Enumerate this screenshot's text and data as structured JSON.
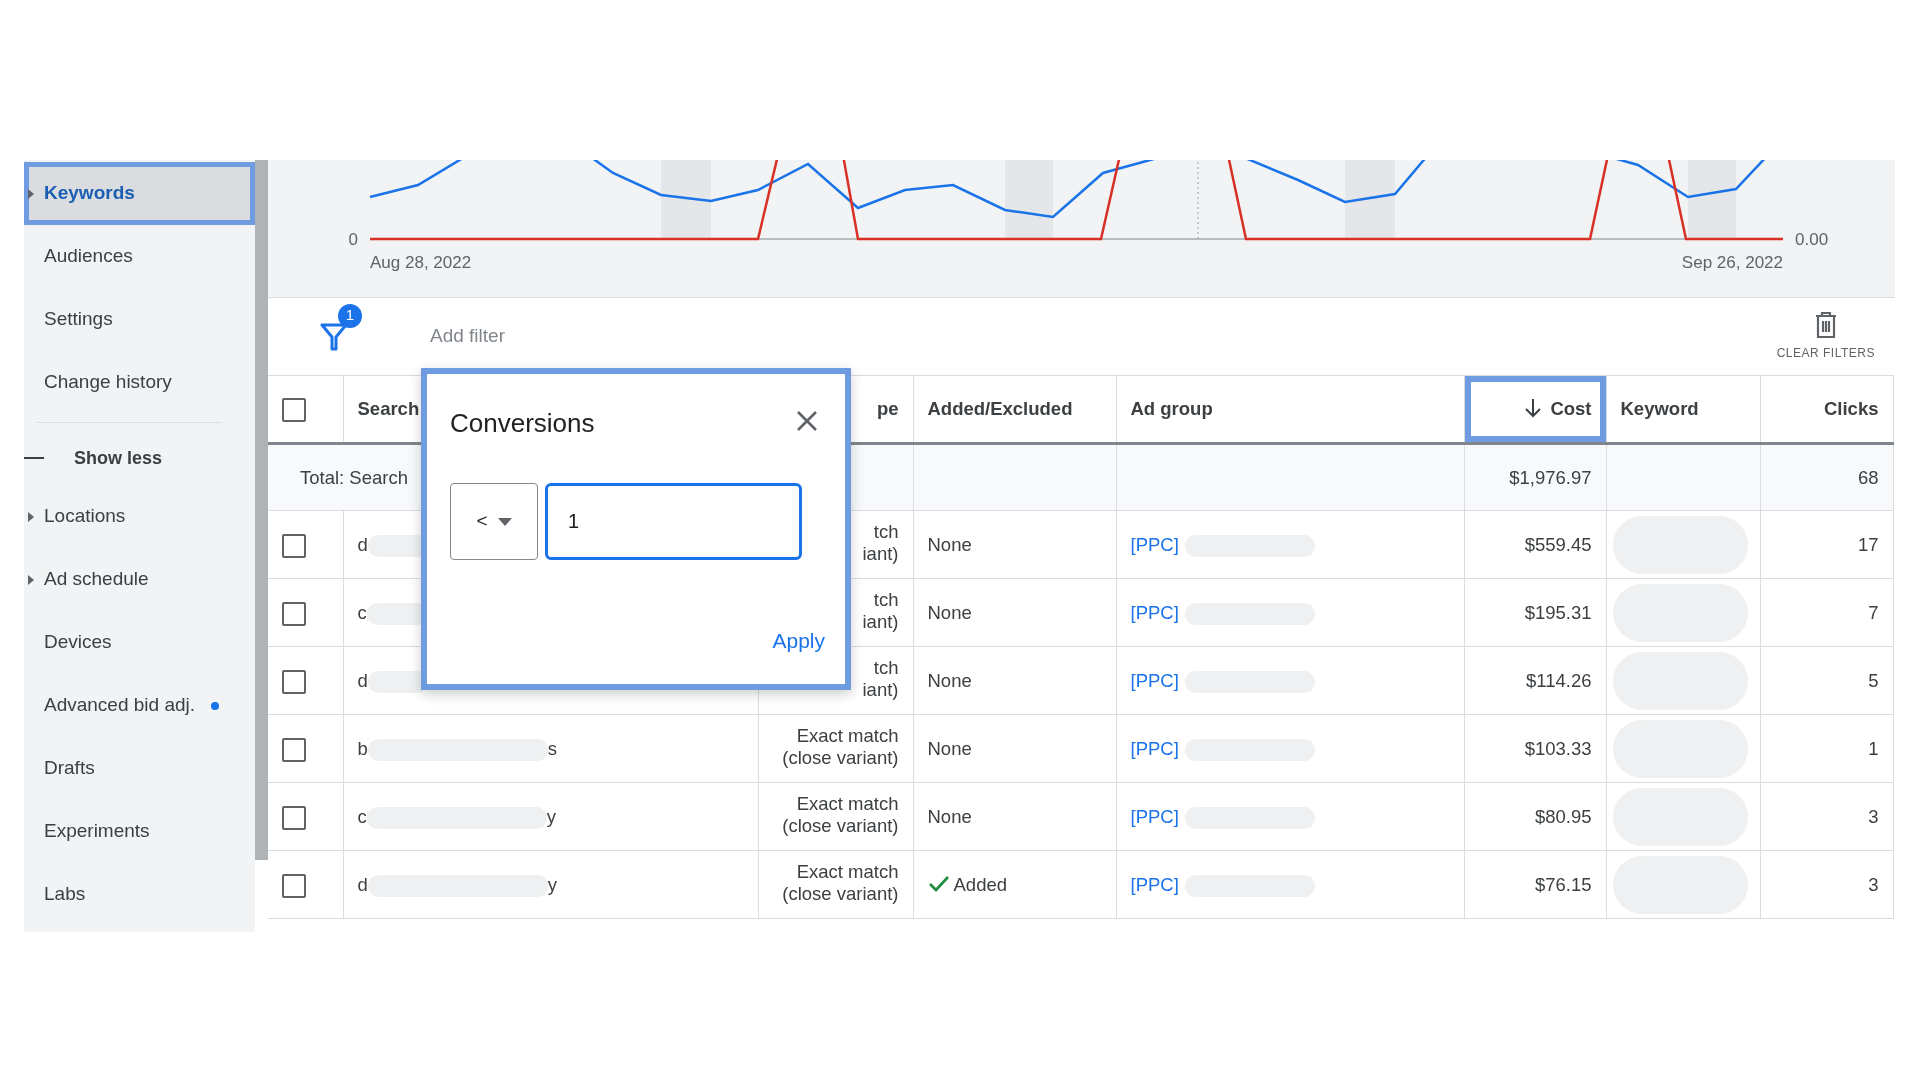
{
  "sidebar": {
    "items": [
      {
        "label": "Keywords",
        "selected": true,
        "highlighted": true,
        "expandable": true,
        "dot": false
      },
      {
        "label": "Audiences",
        "selected": false,
        "highlighted": false,
        "expandable": false,
        "dot": false
      },
      {
        "label": "Settings",
        "selected": false,
        "highlighted": false,
        "expandable": false,
        "dot": false
      },
      {
        "label": "Change history",
        "selected": false,
        "highlighted": false,
        "expandable": false,
        "dot": false
      }
    ],
    "toggle": {
      "label": "Show less"
    },
    "more_items": [
      {
        "label": "Locations",
        "selected": false,
        "highlighted": false,
        "expandable": true,
        "dot": false
      },
      {
        "label": "Ad schedule",
        "selected": false,
        "highlighted": false,
        "expandable": true,
        "dot": false
      },
      {
        "label": "Devices",
        "selected": false,
        "highlighted": false,
        "expandable": false,
        "dot": false
      },
      {
        "label": "Advanced bid adj.",
        "selected": false,
        "highlighted": false,
        "expandable": false,
        "dot": true
      },
      {
        "label": "Drafts",
        "selected": false,
        "highlighted": false,
        "expandable": false,
        "dot": false
      },
      {
        "label": "Experiments",
        "selected": false,
        "highlighted": false,
        "expandable": false,
        "dot": false
      },
      {
        "label": "Labs",
        "selected": false,
        "highlighted": false,
        "expandable": false,
        "dot": false
      }
    ]
  },
  "chart": {
    "y_left_tick": "0",
    "y_right_tick": "0.00",
    "start_date": "Aug 28, 2022",
    "end_date": "Sep 26, 2022"
  },
  "filter_bar": {
    "filter_count": "1",
    "placeholder": "Add filter",
    "clear_label": "CLEAR FILTERS"
  },
  "table": {
    "select_all_checked": false,
    "columns": [
      {
        "label": "Search",
        "sorted": false,
        "highlighted": false
      },
      {
        "label": "pe",
        "sorted": false,
        "highlighted": false
      },
      {
        "label": "Added/Excluded",
        "sorted": false,
        "highlighted": false
      },
      {
        "label": "Ad group",
        "sorted": false,
        "highlighted": false
      },
      {
        "label": "Cost",
        "sorted": true,
        "highlighted": true
      },
      {
        "label": "Keyword",
        "sorted": false,
        "highlighted": false
      },
      {
        "label": "Clicks",
        "sorted": false,
        "highlighted": false
      }
    ],
    "total": {
      "label": "Total: Search",
      "cost": "$1,976.97",
      "clicks": "68"
    },
    "rows": [
      {
        "checked": false,
        "term_start": "d",
        "match_type": [
          "tch",
          "iant)"
        ],
        "added": {
          "kind": "none",
          "label": "None"
        },
        "ad_group": "[PPC]",
        "cost": "$559.45",
        "clicks": "17"
      },
      {
        "checked": false,
        "term_start": "c",
        "match_type": [
          "tch",
          "iant)"
        ],
        "added": {
          "kind": "none",
          "label": "None"
        },
        "ad_group": "[PPC]",
        "cost": "$195.31",
        "clicks": "7"
      },
      {
        "checked": false,
        "term_start": "d",
        "match_type": [
          "tch",
          "iant)"
        ],
        "added": {
          "kind": "none",
          "label": "None"
        },
        "ad_group": "[PPC]",
        "cost": "$114.26",
        "clicks": "5"
      },
      {
        "checked": false,
        "term_start": "b",
        "term_end": "s",
        "match_type": [
          "Exact match",
          "(close variant)"
        ],
        "added": {
          "kind": "none",
          "label": "None"
        },
        "ad_group": "[PPC]",
        "cost": "$103.33",
        "clicks": "1"
      },
      {
        "checked": false,
        "term_start": "c",
        "term_end": "y",
        "match_type": [
          "Exact match",
          "(close variant)"
        ],
        "added": {
          "kind": "none",
          "label": "None"
        },
        "ad_group": "[PPC]",
        "cost": "$80.95",
        "clicks": "3"
      },
      {
        "checked": false,
        "term_start": "d",
        "term_end": "y",
        "match_type": [
          "Exact match",
          "(close variant)"
        ],
        "added": {
          "kind": "added",
          "label": "Added"
        },
        "ad_group": "[PPC]",
        "cost": "$76.15",
        "clicks": "3"
      }
    ]
  },
  "dialog": {
    "title": "Conversions",
    "operator": "<",
    "value": "1",
    "focused": true,
    "apply_label": "Apply"
  }
}
